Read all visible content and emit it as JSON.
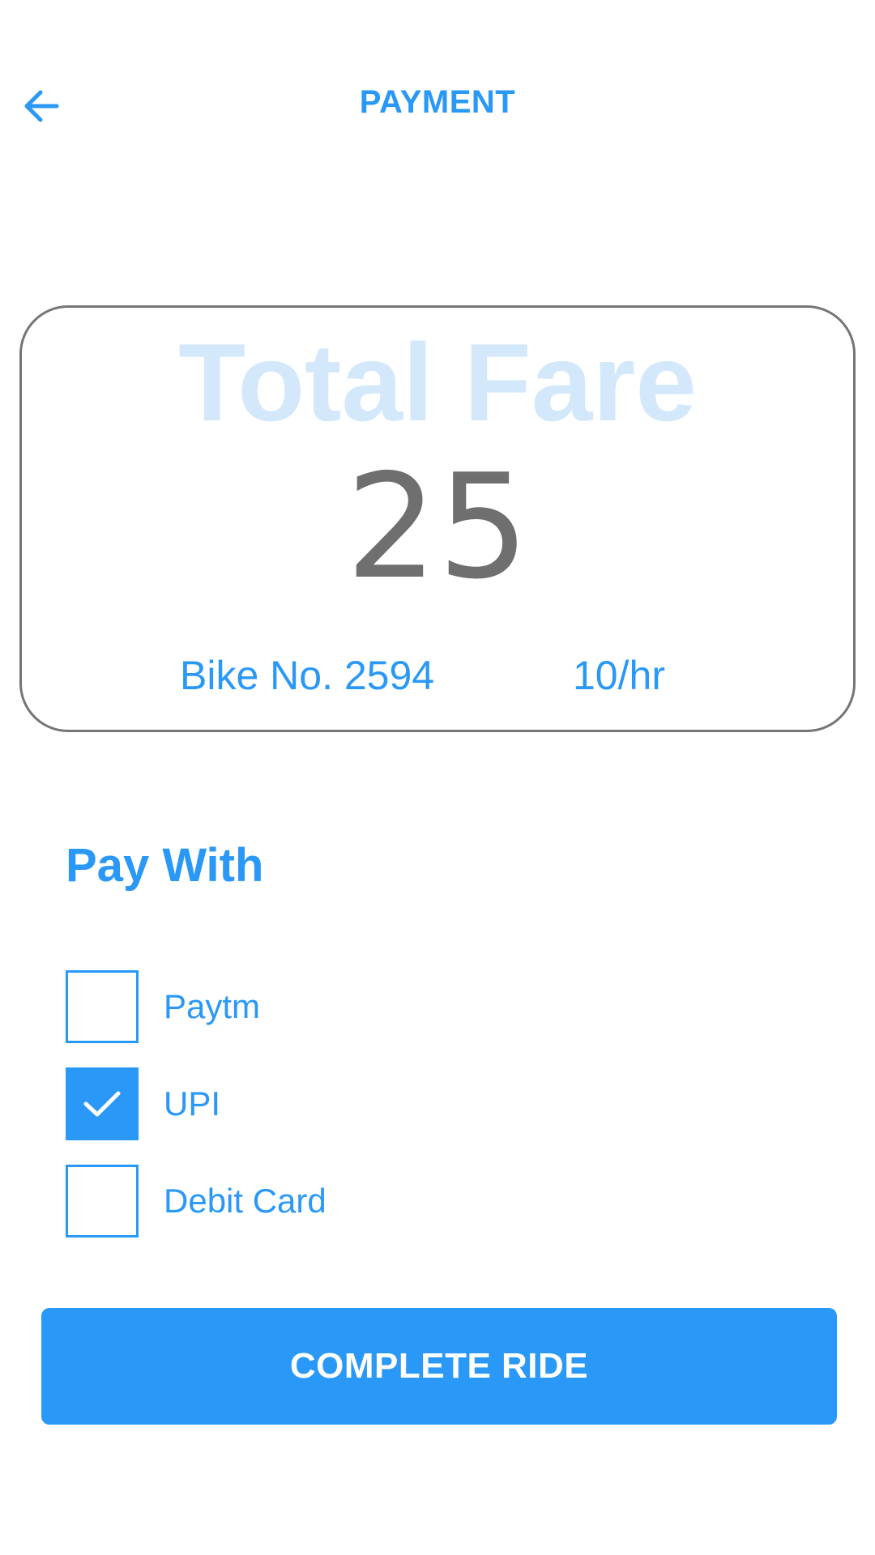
{
  "header": {
    "title": "PAYMENT",
    "back_icon": "arrow-left-icon"
  },
  "fare_card": {
    "title": "Total Fare",
    "amount": "25",
    "bike_number": "Bike No. 2594",
    "rate": "10/hr"
  },
  "payment": {
    "heading": "Pay With",
    "options": [
      {
        "label": "Paytm",
        "checked": false
      },
      {
        "label": "UPI",
        "checked": true
      },
      {
        "label": "Debit Card",
        "checked": false
      }
    ]
  },
  "actions": {
    "complete_label": "COMPLETE RIDE"
  },
  "colors": {
    "accent": "#2a98f7",
    "fare_title": "#d3e8fb",
    "amount_text": "#6f6f6f",
    "card_border": "#757575"
  }
}
